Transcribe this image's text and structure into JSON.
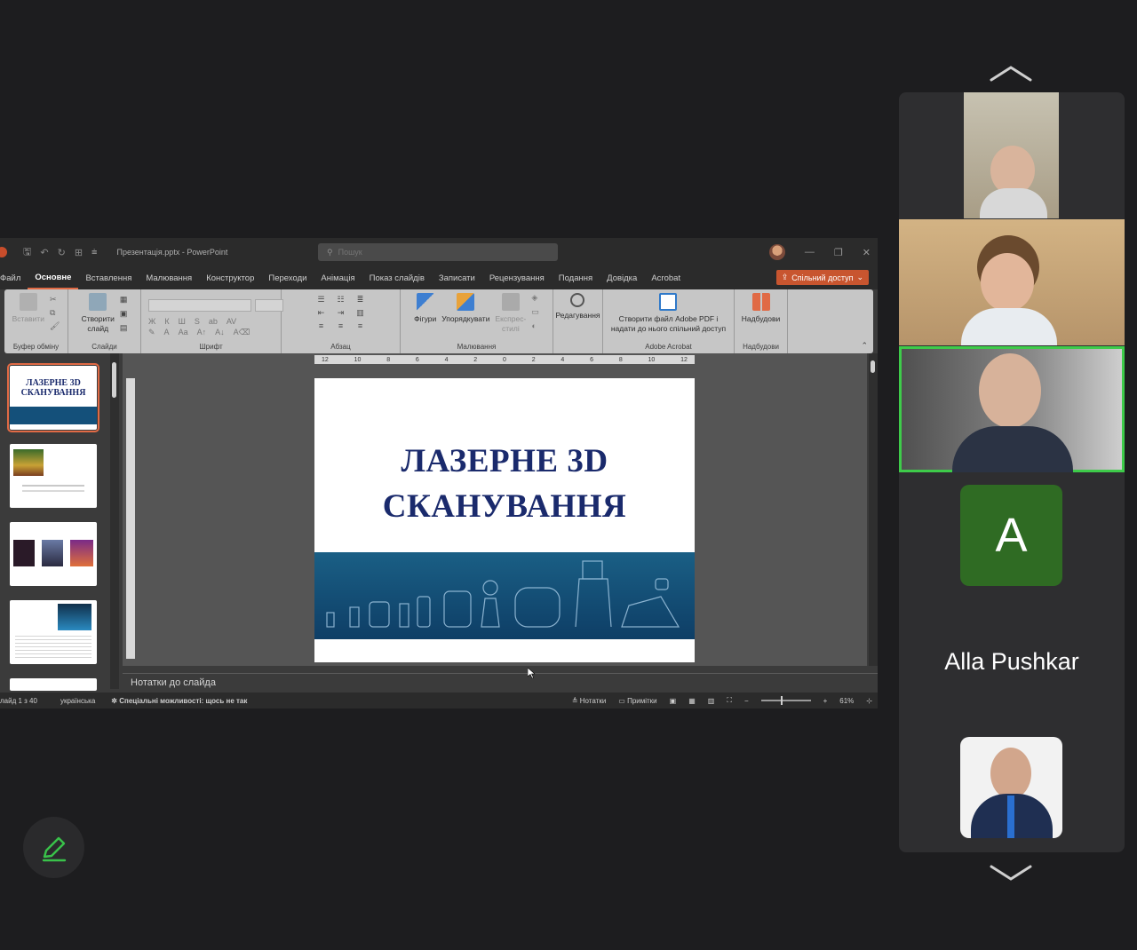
{
  "app": {
    "title": "Презентація.pptx - PowerPoint",
    "search_placeholder": "Пошук"
  },
  "menu": [
    "Файл",
    "Основне",
    "Вставлення",
    "Малювання",
    "Конструктор",
    "Переходи",
    "Анімація",
    "Показ слайдів",
    "Записати",
    "Рецензування",
    "Подання",
    "Довідка",
    "Acrobat"
  ],
  "share_label": "Спільний доступ",
  "ribbon": {
    "clipboard": {
      "paste": "Вставити",
      "label": "Буфер обміну"
    },
    "slides": {
      "new_slide_line1": "Створити",
      "new_slide_line2": "слайд",
      "label": "Слайди"
    },
    "font": {
      "label": "Шрифт"
    },
    "paragraph": {
      "label": "Абзац"
    },
    "drawing": {
      "shapes": "Фігури",
      "arrange": "Упорядкувати",
      "styles_line1": "Експрес-",
      "styles_line2": "стилі",
      "label": "Малювання"
    },
    "editing": {
      "label": "Редагування"
    },
    "acrobat": {
      "line1": "Створити файл Adobe PDF і",
      "line2": "надати до нього спільний доступ",
      "label": "Adobe Acrobat"
    },
    "addins": {
      "button": "Надбудови",
      "label": "Надбудови"
    }
  },
  "ruler_ticks": [
    "12",
    "10",
    "8",
    "6",
    "4",
    "2",
    "0",
    "2",
    "4",
    "6",
    "8",
    "10",
    "12"
  ],
  "thumbnails": {
    "slide1_title": "ЛАЗЕРНЕ 3D СКАНУВАННЯ"
  },
  "slide": {
    "title_line1": "ЛАЗЕРНЕ 3D",
    "title_line2": "СКАНУВАННЯ"
  },
  "notes_placeholder": "Нотатки до слайда",
  "status": {
    "slide_counter": "лайд 1 з 40",
    "language": "українська",
    "accessibility": "Спеціальні можливості: щось не так",
    "notes": "Нотатки",
    "comments": "Примітки",
    "zoom": "61%"
  },
  "participants": {
    "avatar_letter": "A",
    "name": "Alla Pushkar"
  },
  "colors": {
    "accent": "#e06a45",
    "speaking": "#3ecb4a",
    "avatar_green": "#2f6b23",
    "slide_title": "#1a2a6c"
  }
}
